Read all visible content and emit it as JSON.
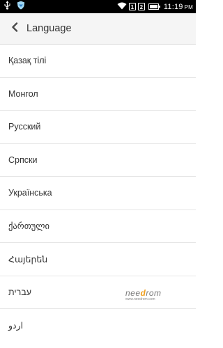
{
  "status_bar": {
    "time": "11:19",
    "ampm": "PM",
    "sim1": "1",
    "sim2": "2",
    "icons": [
      "usb-icon",
      "shield-icon",
      "wifi-icon",
      "sim1-icon",
      "sim2-icon",
      "battery-icon"
    ]
  },
  "app_bar": {
    "title": "Language",
    "back_icon": "chevron-left-icon"
  },
  "languages": [
    "Қазақ тілі",
    "Монгол",
    "Русский",
    "Српски",
    "Українська",
    "ქართული",
    "Հայերեն",
    "עברית",
    "اردو"
  ],
  "watermark": {
    "brand_prefix": "nee",
    "brand_accent": "d",
    "brand_suffix": "rom",
    "url": "www.needrom.com"
  },
  "colors": {
    "status_bar_bg": "#000000",
    "app_bar_bg": "#f5f5f5",
    "text": "#333333",
    "divider": "#e6e6e6"
  }
}
